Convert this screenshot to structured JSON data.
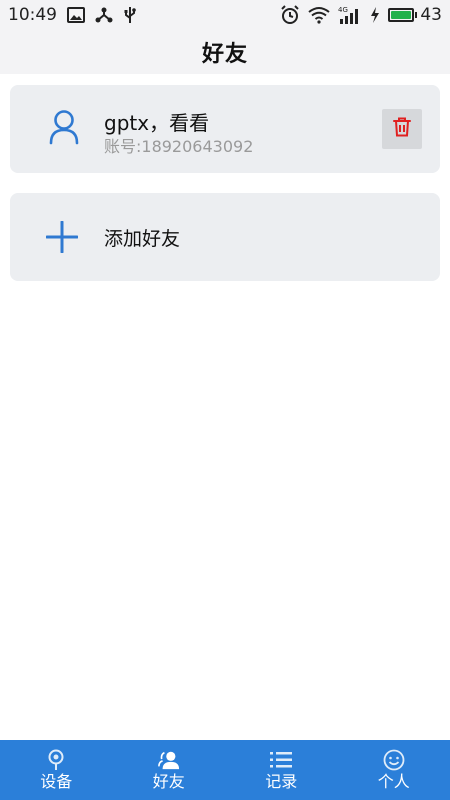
{
  "status_bar": {
    "time": "10:49",
    "battery_level": "43",
    "network": "4G"
  },
  "header": {
    "title": "好友"
  },
  "friends": [
    {
      "name": "gptx，看看",
      "account": "账号:18920643092"
    }
  ],
  "add_friend": {
    "label": "添加好友"
  },
  "bottom_nav": {
    "items": [
      {
        "label": "设备",
        "icon": "location-pin-icon"
      },
      {
        "label": "好友",
        "icon": "friends-icon"
      },
      {
        "label": "记录",
        "icon": "list-icon"
      },
      {
        "label": "个人",
        "icon": "smiley-icon"
      }
    ],
    "active_index": 1
  },
  "colors": {
    "accent": "#2b7fd9",
    "card_bg": "#eceef1",
    "delete_red": "#e02020",
    "icon_blue": "#2f79d1"
  }
}
